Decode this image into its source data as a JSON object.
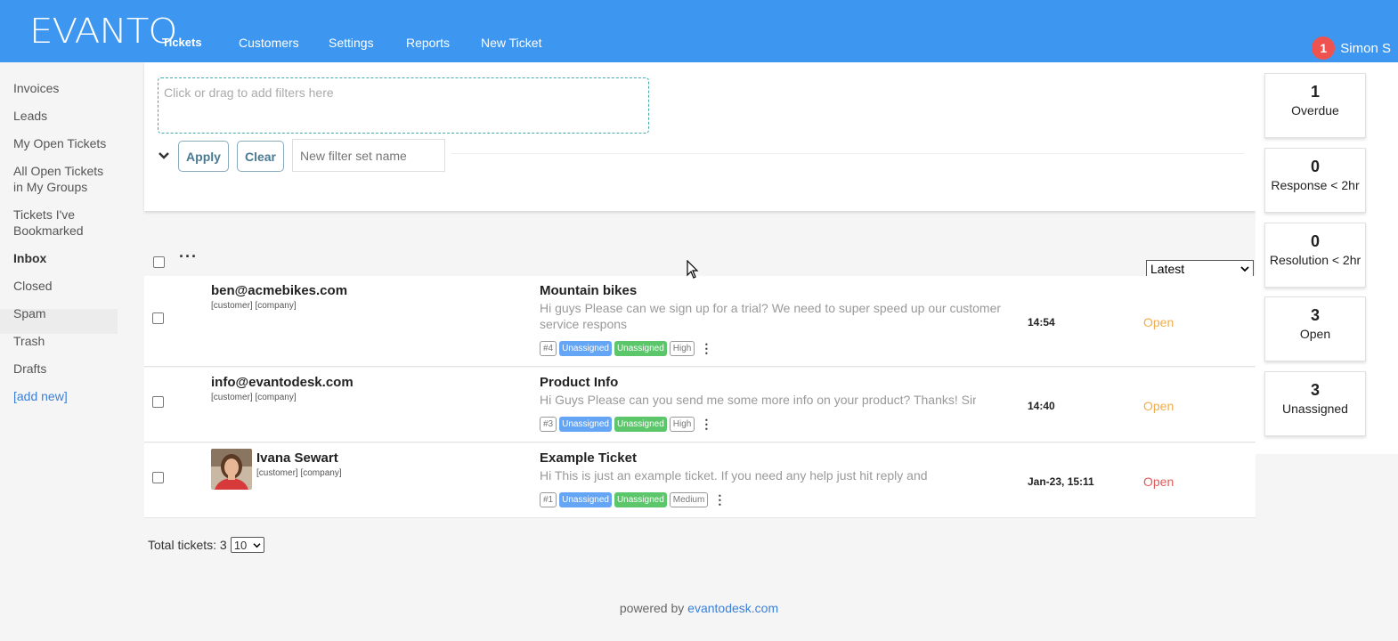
{
  "brand": {
    "logo_text": "EVANTO",
    "accent": "#3d96f0"
  },
  "nav": {
    "items": [
      "Tickets",
      "Customers",
      "Settings",
      "Reports",
      "New Ticket"
    ],
    "active": "Tickets"
  },
  "user": {
    "name": "Simon S",
    "notification_count": "1"
  },
  "sidebar": {
    "items": [
      "Invoices",
      "Leads",
      "My Open Tickets",
      "All Open Tickets in My Groups",
      "Tickets I've Bookmarked",
      "Inbox",
      "Closed",
      "Spam",
      "Trash",
      "Drafts",
      "[add new]"
    ],
    "active": "Inbox"
  },
  "filters": {
    "drop_placeholder": "Click or drag to add filters here",
    "apply_label": "Apply",
    "clear_label": "Clear",
    "filter_name_placeholder": "New filter set name"
  },
  "list": {
    "sort_value": "Latest",
    "tickets": [
      {
        "from": "ben@acmebikes.com",
        "meta": "[customer] [company]",
        "subject": "Mountain bikes",
        "preview_line1": "Hi guys Please can we sign up for a trial? We need to super speed up our customer",
        "preview_line2": "service respons",
        "id": "#4",
        "assignee_user": "Unassigned",
        "assignee_group": "Unassigned",
        "priority": "High",
        "time": "14:54",
        "status": "Open",
        "status_color": "#f0ad4e"
      },
      {
        "from": "info@evantodesk.com",
        "meta": "[customer] [company]",
        "subject": "Product Info",
        "preview_line1": "Hi Guys Please can you send me some more info on your product?  Thanks! Simon",
        "id": "#3",
        "assignee_user": "Unassigned",
        "assignee_group": "Unassigned",
        "priority": "High",
        "time": "14:40",
        "status": "Open",
        "status_color": "#f0ad4e"
      },
      {
        "from": "Ivana Sewart",
        "meta": "[customer] [company]",
        "subject": "Example Ticket",
        "preview_line1": "Hi  This is just an example ticket.  If you need any help just hit reply and I",
        "id": "#1",
        "assignee_user": "Unassigned",
        "assignee_group": "Unassigned",
        "priority": "Medium",
        "time": "Jan-23, 15:11",
        "status": "Open",
        "status_color": "#e05c5c"
      }
    ],
    "total_label": "Total tickets: 3",
    "page_size": "10"
  },
  "stats": [
    {
      "num": "1",
      "label": "Overdue"
    },
    {
      "num": "0",
      "label": "Response < 2hr"
    },
    {
      "num": "0",
      "label": "Resolution < 2hr"
    },
    {
      "num": "3",
      "label": "Open"
    },
    {
      "num": "3",
      "label": "Unassigned"
    }
  ],
  "footer": {
    "prefix": "powered by",
    "link": "evantodesk.com"
  }
}
